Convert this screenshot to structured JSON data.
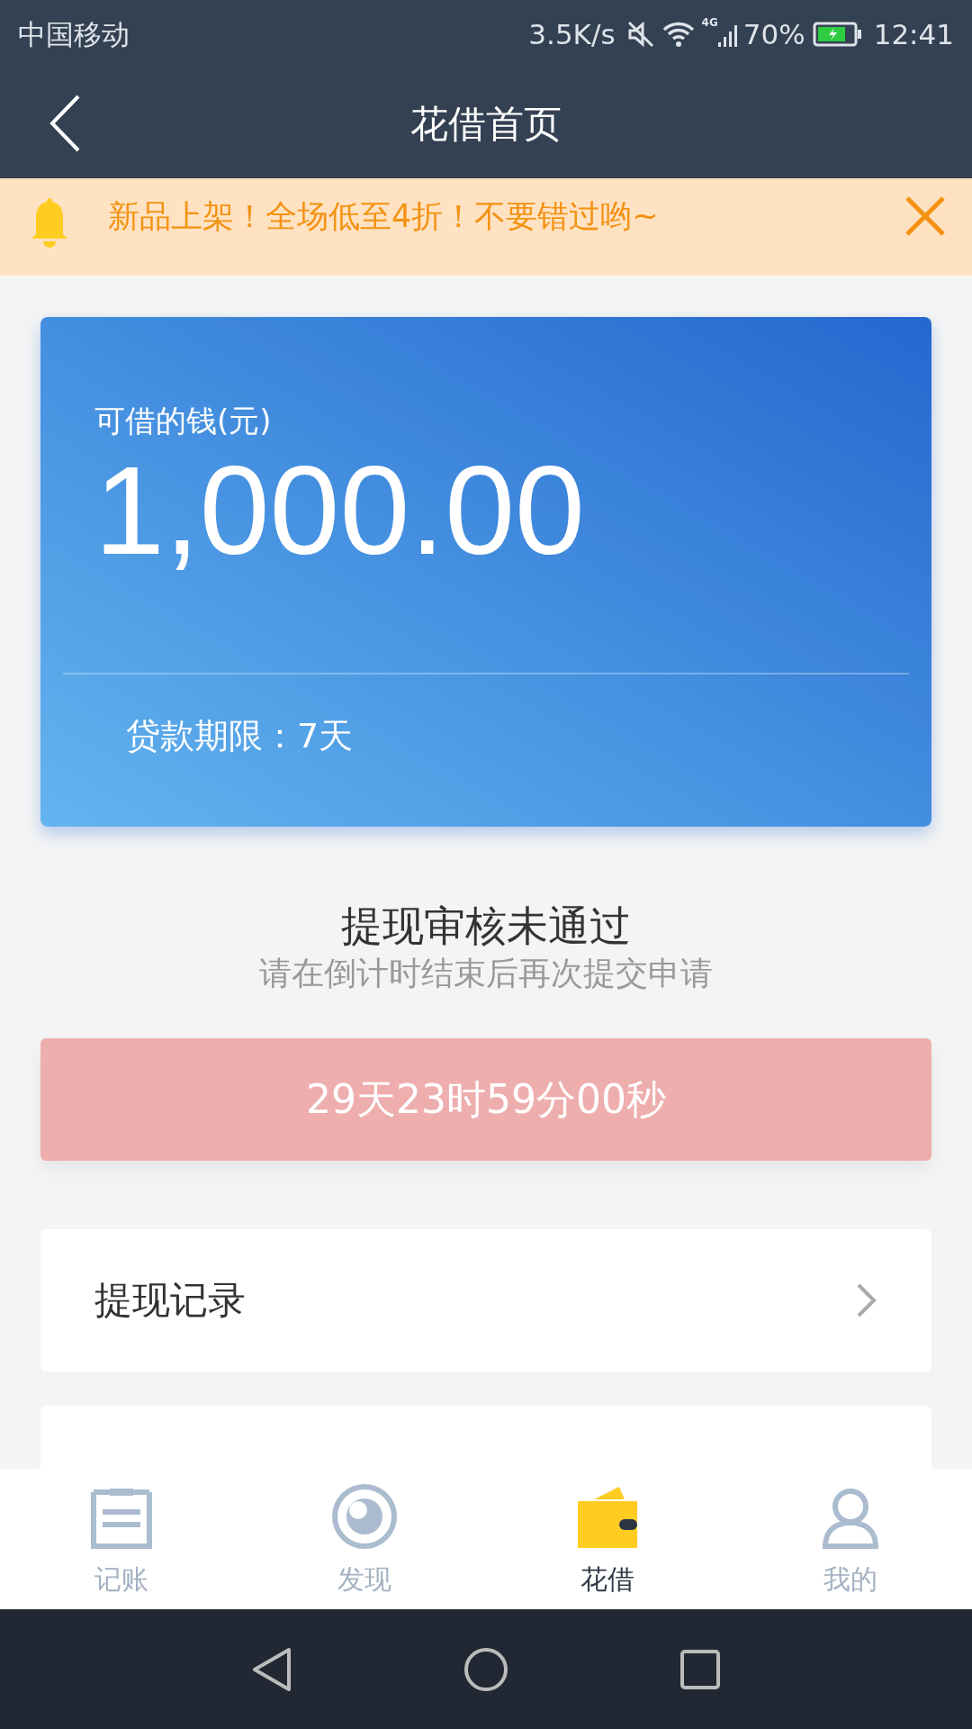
{
  "status_bar": {
    "carrier": "中国移动",
    "network_speed": "3.5K/s",
    "network_type": "4G",
    "battery": "70%",
    "time": "12:41"
  },
  "header": {
    "title": "花借首页"
  },
  "notice": {
    "text": "新品上架！全场低至4折！不要错过哟~"
  },
  "loan_card": {
    "label": "可借的钱(元)",
    "amount": "1,000.00",
    "term": "贷款期限：7天"
  },
  "review": {
    "title": "提现审核未通过",
    "subtitle": "请在倒计时结束后再次提交申请",
    "countdown": "29天23时59分00秒"
  },
  "menu": [
    {
      "kind": "row",
      "label": "提现记录"
    },
    {
      "kind": "cut"
    }
  ],
  "tabs": [
    {
      "kind": "ledger",
      "label": "记账",
      "selected": false
    },
    {
      "kind": "discover",
      "label": "发现",
      "selected": false
    },
    {
      "kind": "wallet",
      "label": "花借",
      "selected": true
    },
    {
      "kind": "profile",
      "label": "我的",
      "selected": false
    }
  ]
}
